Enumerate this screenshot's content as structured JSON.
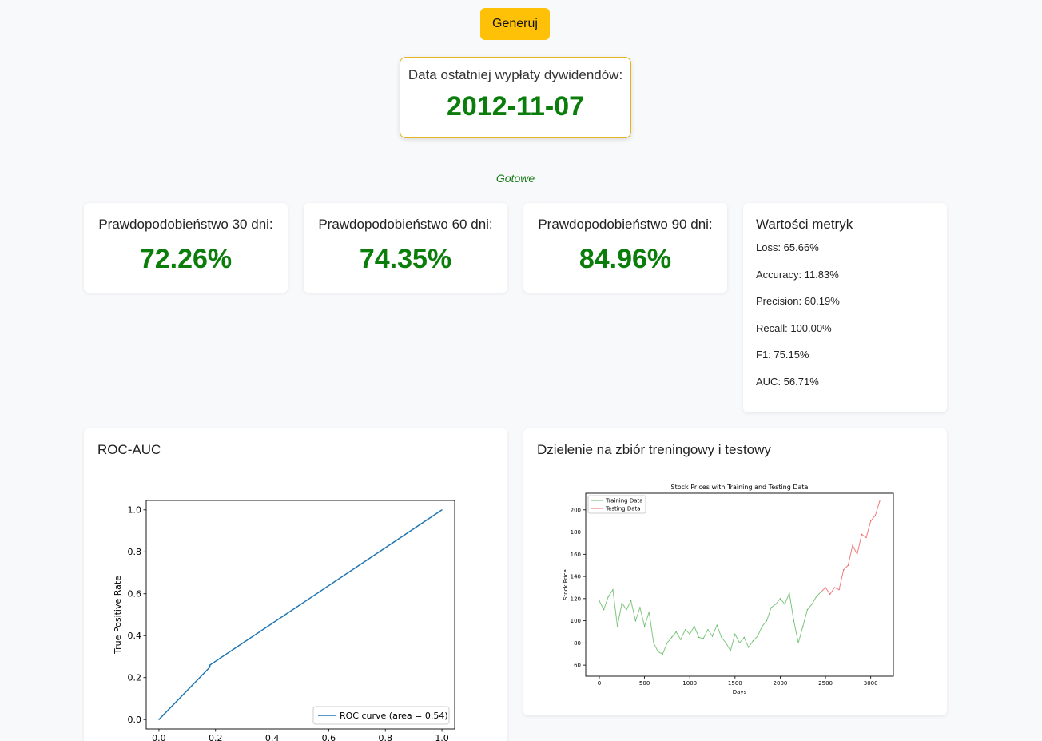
{
  "generate_label": "Generuj",
  "dividend": {
    "label": "Data ostatniej wypłaty dywidendów:",
    "date": "2012-11-07"
  },
  "status": "Gotowe",
  "probabilities": [
    {
      "label": "Prawdopodobieństwo 30 dni:",
      "value": "72.26%"
    },
    {
      "label": "Prawdopodobieństwo 60 dni:",
      "value": "74.35%"
    },
    {
      "label": "Prawdopodobieństwo 90 dni:",
      "value": "84.96%"
    }
  ],
  "metrics": {
    "title": "Wartości metryk",
    "items": [
      "Loss: 65.66%",
      "Accuracy: 11.83%",
      "Precision: 60.19%",
      "Recall: 100.00%",
      "F1: 75.15%",
      "AUC: 56.71%"
    ]
  },
  "roc_card_title": "ROC-AUC",
  "split_card_title": "Dzielenie na zbiór treningowy i testowy",
  "colors": {
    "accent": "#ffc107",
    "positive": "#0a7d0a",
    "roc_line": "#1f77b4",
    "training": "#2ca02c",
    "testing": "#e8262a"
  },
  "chart_data": [
    {
      "type": "line",
      "title": "",
      "xlabel": "",
      "ylabel": "True Positive Rate",
      "xlim": [
        0,
        1
      ],
      "ylim": [
        0,
        1
      ],
      "x_ticks": [
        "0.0",
        "0.2",
        "0.4",
        "0.6",
        "0.8",
        "1.0"
      ],
      "y_ticks": [
        "0.0",
        "0.2",
        "0.4",
        "0.6",
        "0.8",
        "1.0"
      ],
      "series": [
        {
          "name": "ROC curve (area = 0.54)",
          "x": [
            0.0,
            0.18,
            0.18,
            1.0
          ],
          "y": [
            0.0,
            0.25,
            0.26,
            1.0
          ]
        }
      ],
      "legend": "lower-right"
    },
    {
      "type": "line",
      "title": "Stock Prices with Training and Testing Data",
      "xlabel": "Days",
      "ylabel": "Stock Price",
      "xlim": [
        -150,
        3250
      ],
      "ylim": [
        50,
        215
      ],
      "x_ticks": [
        "0",
        "500",
        "1000",
        "1500",
        "2000",
        "2500",
        "3000"
      ],
      "y_ticks": [
        "60",
        "80",
        "100",
        "120",
        "140",
        "160",
        "180",
        "200"
      ],
      "series": [
        {
          "name": "Training Data",
          "x": [
            0,
            50,
            100,
            150,
            200,
            250,
            300,
            350,
            400,
            450,
            500,
            550,
            600,
            650,
            700,
            750,
            800,
            850,
            900,
            950,
            1000,
            1050,
            1100,
            1150,
            1200,
            1250,
            1300,
            1350,
            1400,
            1450,
            1500,
            1550,
            1600,
            1650,
            1700,
            1750,
            1800,
            1850,
            1900,
            1950,
            2000,
            2050,
            2100,
            2150,
            2200,
            2250,
            2300,
            2350,
            2400,
            2450
          ],
          "y": [
            118,
            110,
            122,
            128,
            95,
            116,
            110,
            118,
            100,
            112,
            95,
            108,
            80,
            72,
            70,
            80,
            85,
            90,
            83,
            92,
            88,
            95,
            85,
            84,
            92,
            86,
            96,
            85,
            80,
            73,
            88,
            80,
            85,
            76,
            82,
            86,
            95,
            100,
            112,
            115,
            120,
            115,
            125,
            100,
            80,
            95,
            110,
            115,
            122,
            126
          ]
        },
        {
          "name": "Testing Data",
          "x": [
            2450,
            2500,
            2550,
            2600,
            2650,
            2700,
            2750,
            2800,
            2850,
            2900,
            2950,
            3000,
            3050,
            3100
          ],
          "y": [
            126,
            130,
            124,
            130,
            128,
            146,
            150,
            168,
            160,
            178,
            175,
            190,
            195,
            208
          ]
        }
      ],
      "legend": "top-left"
    }
  ]
}
